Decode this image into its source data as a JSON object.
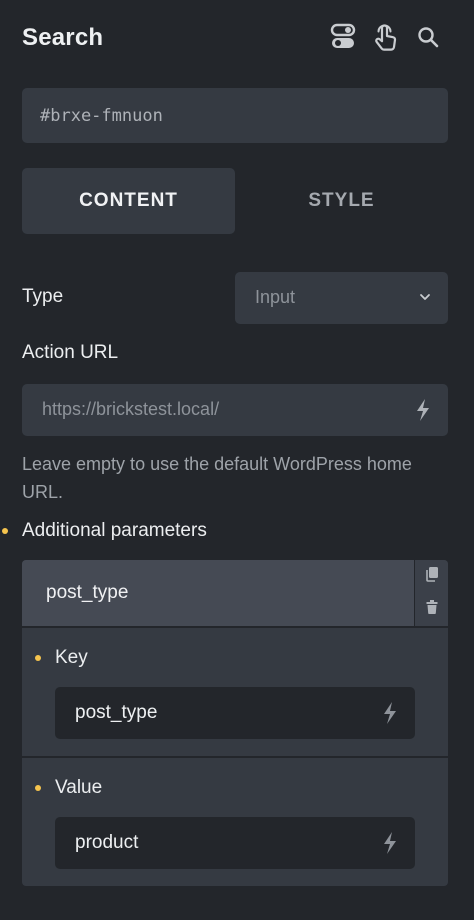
{
  "header": {
    "title": "Search",
    "icons": [
      "toggle-icon",
      "pointer-hand-icon",
      "search-icon"
    ]
  },
  "element_id": {
    "value": "#brxe-fmnuon"
  },
  "tabs": [
    {
      "label": "CONTENT",
      "active": true
    },
    {
      "label": "STYLE",
      "active": false
    }
  ],
  "fields": {
    "type": {
      "label": "Type",
      "value": "Input"
    },
    "action_url": {
      "label": "Action URL",
      "placeholder": "https://brickstest.local/",
      "help": "Leave empty to use the default WordPress home URL."
    }
  },
  "additional_parameters": {
    "label": "Additional parameters",
    "items": [
      {
        "title": "post_type",
        "key_label": "Key",
        "key_value": "post_type",
        "value_label": "Value",
        "value_value": "product"
      }
    ]
  },
  "colors": {
    "background": "#23262b",
    "panel": "#353a42",
    "accent_dot": "#f5c44e"
  }
}
